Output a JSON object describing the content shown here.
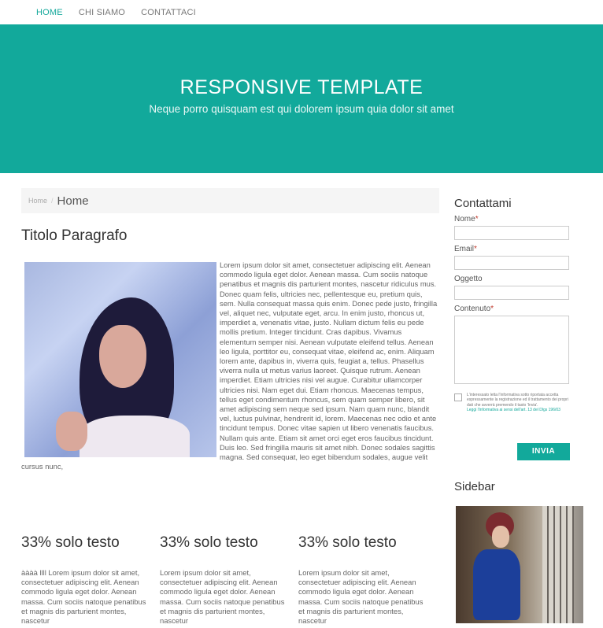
{
  "nav": {
    "items": [
      {
        "label": "HOME",
        "active": true
      },
      {
        "label": "CHI SIAMO"
      },
      {
        "label": "CONTATTACI"
      }
    ]
  },
  "hero": {
    "title": "RESPONSIVE TEMPLATE",
    "subtitle": "Neque porro quisquam est qui dolorem ipsum quia dolor sit amet"
  },
  "breadcrumb": {
    "home": "Home",
    "separator": "/",
    "current": "Home"
  },
  "main": {
    "title": "Titolo Paragrafo",
    "body": "Lorem ipsum dolor sit amet, consectetuer adipiscing elit. Aenean commodo ligula eget dolor. Aenean massa. Cum sociis natoque penatibus et magnis dis parturient montes, nascetur ridiculus mus. Donec quam felis, ultricies nec, pellentesque eu, pretium quis, sem. Nulla consequat massa quis enim. Donec pede justo, fringilla vel, aliquet nec, vulputate eget, arcu. In enim justo, rhoncus ut, imperdiet a, venenatis vitae, justo. Nullam dictum felis eu pede mollis pretium. Integer tincidunt. Cras dapibus. Vivamus elementum semper nisi. Aenean vulputate eleifend tellus. Aenean leo ligula, porttitor eu, consequat vitae, eleifend ac, enim. Aliquam lorem ante, dapibus in, viverra quis, feugiat a, tellus. Phasellus viverra nulla ut metus varius laoreet. Quisque rutrum. Aenean imperdiet. Etiam ultricies nisi vel augue. Curabitur ullamcorper ultricies nisi. Nam eget dui. Etiam rhoncus. Maecenas tempus, tellus eget condimentum rhoncus, sem quam semper libero, sit amet adipiscing sem neque sed ipsum. Nam quam nunc, blandit vel, luctus pulvinar, hendrerit id, lorem. Maecenas nec odio et ante tincidunt tempus. Donec vitae sapien ut libero venenatis faucibus. Nullam quis ante. Etiam sit amet orci eget eros faucibus tincidunt. Duis leo. Sed fringilla mauris sit amet nibh. Donec sodales sagittis magna. Sed consequat, leo eget bibendum sodales, augue velit cursus nunc,"
  },
  "columns": [
    {
      "title": "33% solo testo",
      "text": "àààà llll Lorem ipsum dolor sit amet, consectetuer adipiscing elit. Aenean commodo ligula eget dolor. Aenean massa. Cum sociis natoque penatibus et magnis dis parturient montes, nascetur"
    },
    {
      "title": "33% solo testo",
      "text": "Lorem ipsum dolor sit amet, consectetuer adipiscing elit. Aenean commodo ligula eget dolor. Aenean massa. Cum sociis natoque penatibus et magnis dis parturient montes, nascetur"
    },
    {
      "title": "33% solo testo",
      "text": "Lorem ipsum dolor sit amet, consectetuer adipiscing elit. Aenean commodo ligula eget dolor. Aenean massa. Cum sociis natoque penatibus et magnis dis parturient montes, nascetur"
    }
  ],
  "contact": {
    "title": "Contattami",
    "fields": {
      "name": "Nome",
      "email": "Email",
      "subject": "Oggetto",
      "content": "Contenuto",
      "required_mark": "*"
    },
    "privacy_text": "L'interessato letta l'informativa sotto riportata accetta espressamente la registrazione ed il trattamento dei propri dati che avverrà premendo il tasto 'Invia'.",
    "privacy_link": "Leggi l'informativa ai sensi dell'art. 13 del Dlgs 196/03",
    "submit": "INVIA"
  },
  "sidebar": {
    "title": "Sidebar"
  },
  "colors": {
    "accent": "#12a99b"
  }
}
